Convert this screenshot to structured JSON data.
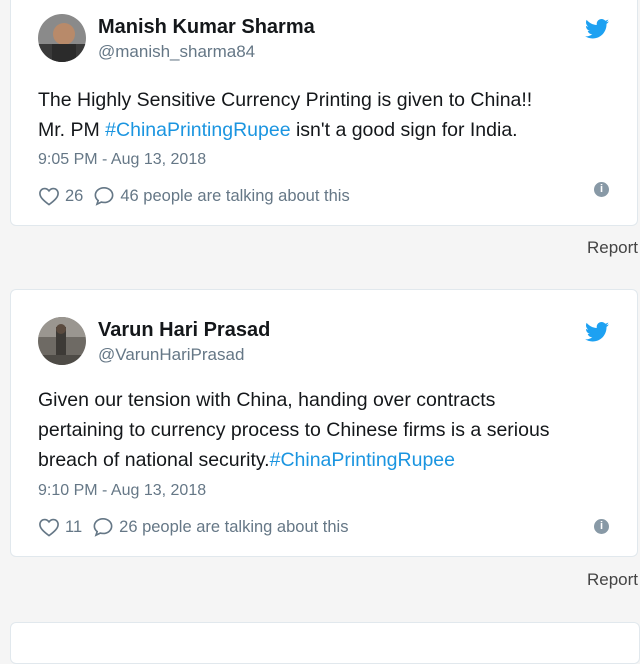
{
  "tweets": [
    {
      "name": "Manish Kumar Sharma",
      "handle": "@manish_sharma84",
      "text_lines": [
        "The Highly Sensitive Currency Printing is given to China!!",
        "Mr. PM ",
        " isn't a good sign for India."
      ],
      "hashtag": "#ChinaPrintingRupee",
      "timestamp": "9:05 PM - Aug 13, 2018",
      "likes": "26",
      "talking": "46 people are talking about this",
      "report": "Report"
    },
    {
      "name": "Varun Hari Prasad",
      "handle": "@VarunHariPrasad",
      "text_lines": [
        "Given our tension with China, handing over contracts",
        "pertaining to currency process to Chinese firms is a serious",
        "breach of national security."
      ],
      "hashtag": "#ChinaPrintingRupee",
      "timestamp": "9:10 PM - Aug 13, 2018",
      "likes": "11",
      "talking": "26 people are talking about this",
      "report": "Report"
    }
  ],
  "colors": {
    "twitter_blue": "#1da1f2",
    "hashtag": "#1b95e0",
    "secondary_text": "#657786"
  },
  "icons": {
    "logo": "twitter-bird-icon",
    "like": "heart-icon",
    "reply": "speech-bubble-icon",
    "info": "info-icon"
  }
}
